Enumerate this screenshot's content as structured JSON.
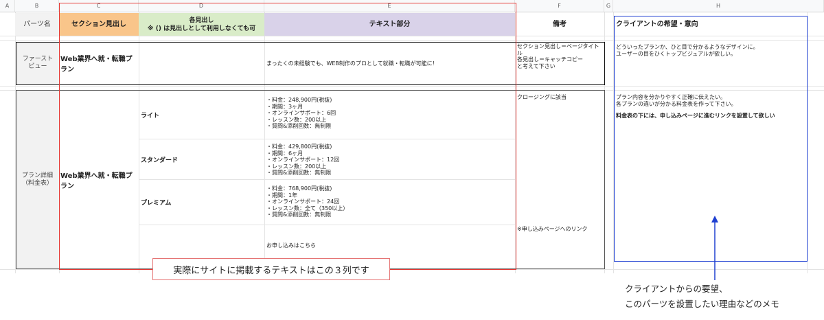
{
  "column_headers": [
    "A",
    "B",
    "C",
    "D",
    "E",
    "F",
    "G",
    "H"
  ],
  "header_row": {
    "parts": "パーツ名",
    "section": "セクション見出し",
    "sub_heading": "各見出し\n※ () は見出しとして利用しなくても可",
    "text_part": "テキスト部分",
    "remarks": "備考",
    "client_wish": "クライアントの希望・意向"
  },
  "first_view": {
    "part_name": "ファースト\nビュー",
    "section": "Web業界へ就・転職プラン",
    "text": "まったくの未経験でも、WEB制作のプロとして就職・転職が可能に！",
    "remark": "セクション見出し＝ページタイトル\n各見出し＝キャッチコピー\nと考えて下さい",
    "client": "どういったプランか、ひと目で分かるようなデザインに。\nユーザーの目をひくトップビジュアルが欲しい。"
  },
  "plan": {
    "part_name": "プラン詳細\n（料金表）",
    "section": "Web業界へ就・転職プラン",
    "remark_top": "クロージングに該当",
    "remark_link": "※申し込みページへのリンク",
    "client": "プラン内容を分かりやすく正確に伝えたい。\n各プランの違いが分かる料金表を作って下さい。",
    "client_bold": "料金表の下には、申し込みページに進むリンクを設置して欲しい",
    "rows": [
      {
        "name": "ライト",
        "text": "・料金：248,900円(税抜)\n・期間：3ヶ月\n・オンラインサポート：6回\n・レッスン数：200以上\n・質問&添削回数：無制限"
      },
      {
        "name": "スタンダード",
        "text": "・料金：429,800円(税抜)\n・期間：6ヶ月\n・オンラインサポート：12回\n・レッスン数：200以上\n・質問&添削回数：無制限"
      },
      {
        "name": "プレミアム",
        "text": "・料金：768,900円(税抜)\n・期間：1年\n・オンラインサポート：24回\n・レッスン数：全て（350以上）\n・質問&添削回数：無制限"
      }
    ],
    "apply_text": "お申し込みはこちら"
  },
  "annotations": {
    "callout": "実際にサイトに掲載するテキストはこの３列です",
    "memo": "クライアントからの要望、\nこのパーツを設置したい理由などのメモ"
  },
  "colors": {
    "section_header_bg": "#f9c58a",
    "sub_heading_bg": "#d9ecc8",
    "text_header_bg": "#d9d2e9",
    "red_box": "#e53935",
    "blue_box": "#1e3fd1",
    "arrow": "#1e3fd1"
  }
}
